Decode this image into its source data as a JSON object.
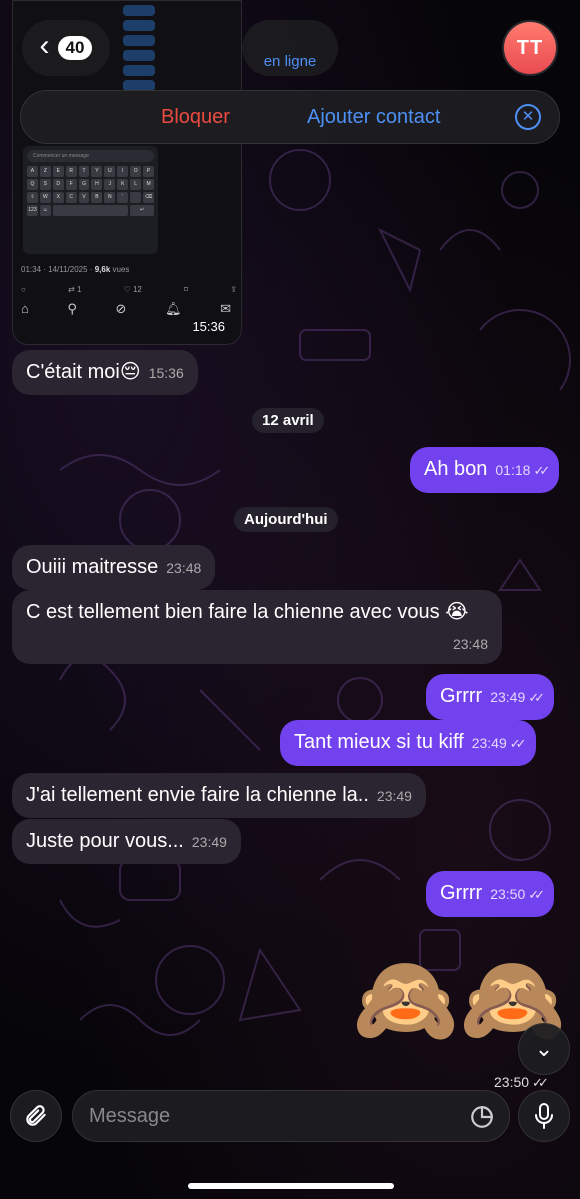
{
  "header": {
    "back_count": "40",
    "status": "en ligne",
    "avatar_initials": "TT",
    "avatar_color": "#ea4b52"
  },
  "action_bar": {
    "block_label": "Bloquer",
    "add_contact_label": "Ajouter contact",
    "block_color": "#ec4a3f",
    "add_color": "#4d90f6"
  },
  "shared_screenshot": {
    "message_placeholder": "Commencer un message",
    "meta_date": "01:34 · 14/11/2025 ·",
    "meta_views_count": "9,6k",
    "meta_views_label": "vues",
    "reply_count": "1",
    "like_count": "12",
    "time": "15:36"
  },
  "messages": [
    {
      "id": "m1",
      "dir": "in",
      "text": "C'était moi😔",
      "time": "15:36"
    },
    {
      "id": "d1",
      "type": "date",
      "text": "12 avril"
    },
    {
      "id": "m2",
      "dir": "out",
      "text": "Ah bon",
      "time": "01:18"
    },
    {
      "id": "d2",
      "type": "date",
      "text": "Aujourd'hui"
    },
    {
      "id": "m3",
      "dir": "in",
      "text": "Ouiii maitresse",
      "time": "23:48"
    },
    {
      "id": "m4",
      "dir": "in",
      "text": "C est tellement bien faire la chienne avec vous 😭",
      "time": "23:48"
    },
    {
      "id": "m5",
      "dir": "out",
      "text": "Grrrr",
      "time": "23:49"
    },
    {
      "id": "m6",
      "dir": "out",
      "text": "Tant mieux si tu kiff",
      "time": "23:49"
    },
    {
      "id": "m7",
      "dir": "in",
      "text": "J'ai tellement envie faire la chienne la..",
      "time": "23:49"
    },
    {
      "id": "m8",
      "dir": "in",
      "text": "Juste pour vous...",
      "time": "23:49"
    },
    {
      "id": "m9",
      "dir": "out",
      "text": "Grrrr",
      "time": "23:50"
    },
    {
      "id": "m10",
      "dir": "out",
      "type": "emoji",
      "text": "🙈🙈",
      "time": "23:50"
    }
  ],
  "input": {
    "placeholder": "Message"
  },
  "colors": {
    "outgoing_bubble": "#7242ee",
    "incoming_bubble": "#2a2531",
    "link_blue": "#4d90f6"
  }
}
